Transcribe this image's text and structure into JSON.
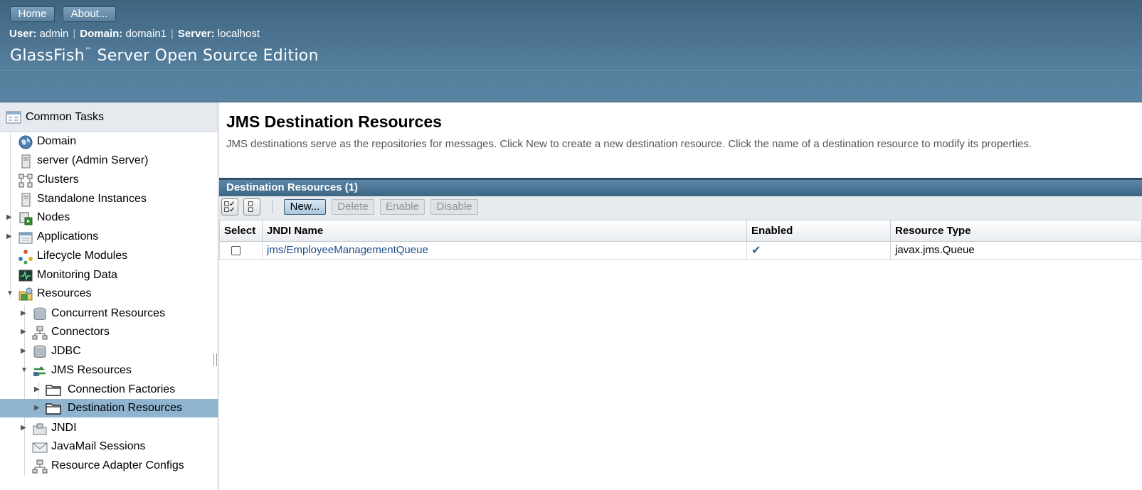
{
  "header": {
    "buttons": {
      "home": "Home",
      "about": "About..."
    },
    "user_label": "User:",
    "user": "admin",
    "domain_label": "Domain:",
    "domain": "domain1",
    "server_label": "Server:",
    "server": "localhost",
    "product_name": "GlassFish",
    "product_tm": "™",
    "product_suffix": " Server Open Source Edition"
  },
  "nav": {
    "common_tasks": "Common Tasks",
    "items": [
      {
        "label": "Domain",
        "icon": "globe-icon"
      },
      {
        "label": "server (Admin Server)",
        "icon": "server-icon"
      },
      {
        "label": "Clusters",
        "icon": "cluster-icon"
      },
      {
        "label": "Standalone Instances",
        "icon": "server-icon"
      },
      {
        "label": "Nodes",
        "icon": "nodes-icon"
      },
      {
        "label": "Applications",
        "icon": "applications-icon"
      },
      {
        "label": "Lifecycle Modules",
        "icon": "lifecycle-icon"
      },
      {
        "label": "Monitoring Data",
        "icon": "monitor-icon"
      },
      {
        "label": "Resources",
        "icon": "resources-icon"
      },
      {
        "label": "Concurrent Resources",
        "icon": "database-icon"
      },
      {
        "label": "Connectors",
        "icon": "connector-icon"
      },
      {
        "label": "JDBC",
        "icon": "database-icon"
      },
      {
        "label": "JMS Resources",
        "icon": "jms-icon"
      },
      {
        "label": "Connection Factories",
        "icon": "folder-icon"
      },
      {
        "label": "Destination Resources",
        "icon": "folder-icon"
      },
      {
        "label": "JNDI",
        "icon": "jndi-icon"
      },
      {
        "label": "JavaMail Sessions",
        "icon": "mail-icon"
      },
      {
        "label": "Resource Adapter Configs",
        "icon": "connector-icon"
      }
    ]
  },
  "main": {
    "title": "JMS Destination Resources",
    "help": "JMS destinations serve as the repositories for messages. Click New to create a new destination resource. Click the name of a destination resource to modify its properties.",
    "table_title": "Destination Resources (1)",
    "toolbar": {
      "new": "New...",
      "delete": "Delete",
      "enable": "Enable",
      "disable": "Disable"
    },
    "columns": [
      "Select",
      "JNDI Name",
      "Enabled",
      "Resource Type"
    ],
    "rows": [
      {
        "jndi_name": "jms/EmployeeManagementQueue",
        "enabled": "✔",
        "resource_type": "javax.jms.Queue"
      }
    ]
  },
  "colors": {
    "header": "#4d7593",
    "selected": "#8fb4cf",
    "link": "#1c4e8a"
  }
}
